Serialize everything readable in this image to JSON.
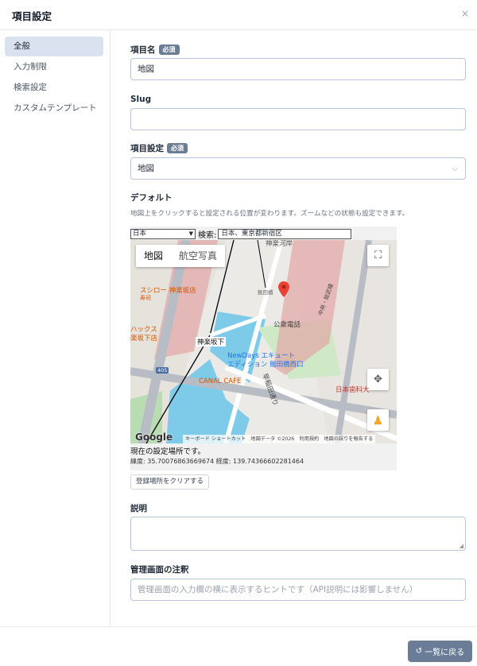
{
  "header": {
    "title": "項目設定",
    "close": "×"
  },
  "sidebar": {
    "items": [
      {
        "label": "全般"
      },
      {
        "label": "入力制限"
      },
      {
        "label": "検索設定"
      },
      {
        "label": "カスタムテンプレート"
      }
    ]
  },
  "fields": {
    "name": {
      "label": "項目名",
      "badge": "必須",
      "value": "地図"
    },
    "slug": {
      "label": "Slug",
      "value": ""
    },
    "type": {
      "label": "項目設定",
      "badge": "必須",
      "value": "地図"
    },
    "default": {
      "label": "デフォルト",
      "help": "地図上をクリックすると設定される位置が変わります。ズームなどの状態も設定できます。"
    },
    "description": {
      "label": "説明",
      "value": ""
    },
    "admin_note": {
      "label": "管理画面の注釈",
      "placeholder": "管理画面の入力欄の横に表示するヒントです（API説明には影響しません）"
    }
  },
  "map": {
    "country": "日本",
    "search_label": "検索:",
    "search_value": "日本、東京都新宿区",
    "maptype_map": "地図",
    "maptype_satellite": "航空写真",
    "places": {
      "kagurazaka_river": "神楽河岸",
      "sushiro": "スシロー 神楽坂店",
      "sushiro_sub": "寿司",
      "hacks": "ハックス",
      "hacks2": "楽坂下店",
      "kagurazakashita": "神楽坂下",
      "koshu": "公衆電話",
      "newdays": "NewDays エキュート",
      "newdays2": "エディション 飯田橋西口",
      "canal": "CANAL CAFE",
      "waseda": "早稲田通り",
      "nihon": "日本歯科大",
      "chuo": "中央・総武線",
      "iidabashi": "飯田橋",
      "r405": "405"
    },
    "attribution": "キーボード ショートカット　地図データ ©2026　利用規約　地図の誤りを報告する",
    "google": "Google",
    "current_text": "現在の設定場所です。",
    "coords_text": "緯度: 35.70076863669674 経度: 139.74366602281464",
    "clear_button": "登録場所をクリアする"
  },
  "footer": {
    "back_button": "一覧に戻る",
    "back_icon": "↺"
  }
}
